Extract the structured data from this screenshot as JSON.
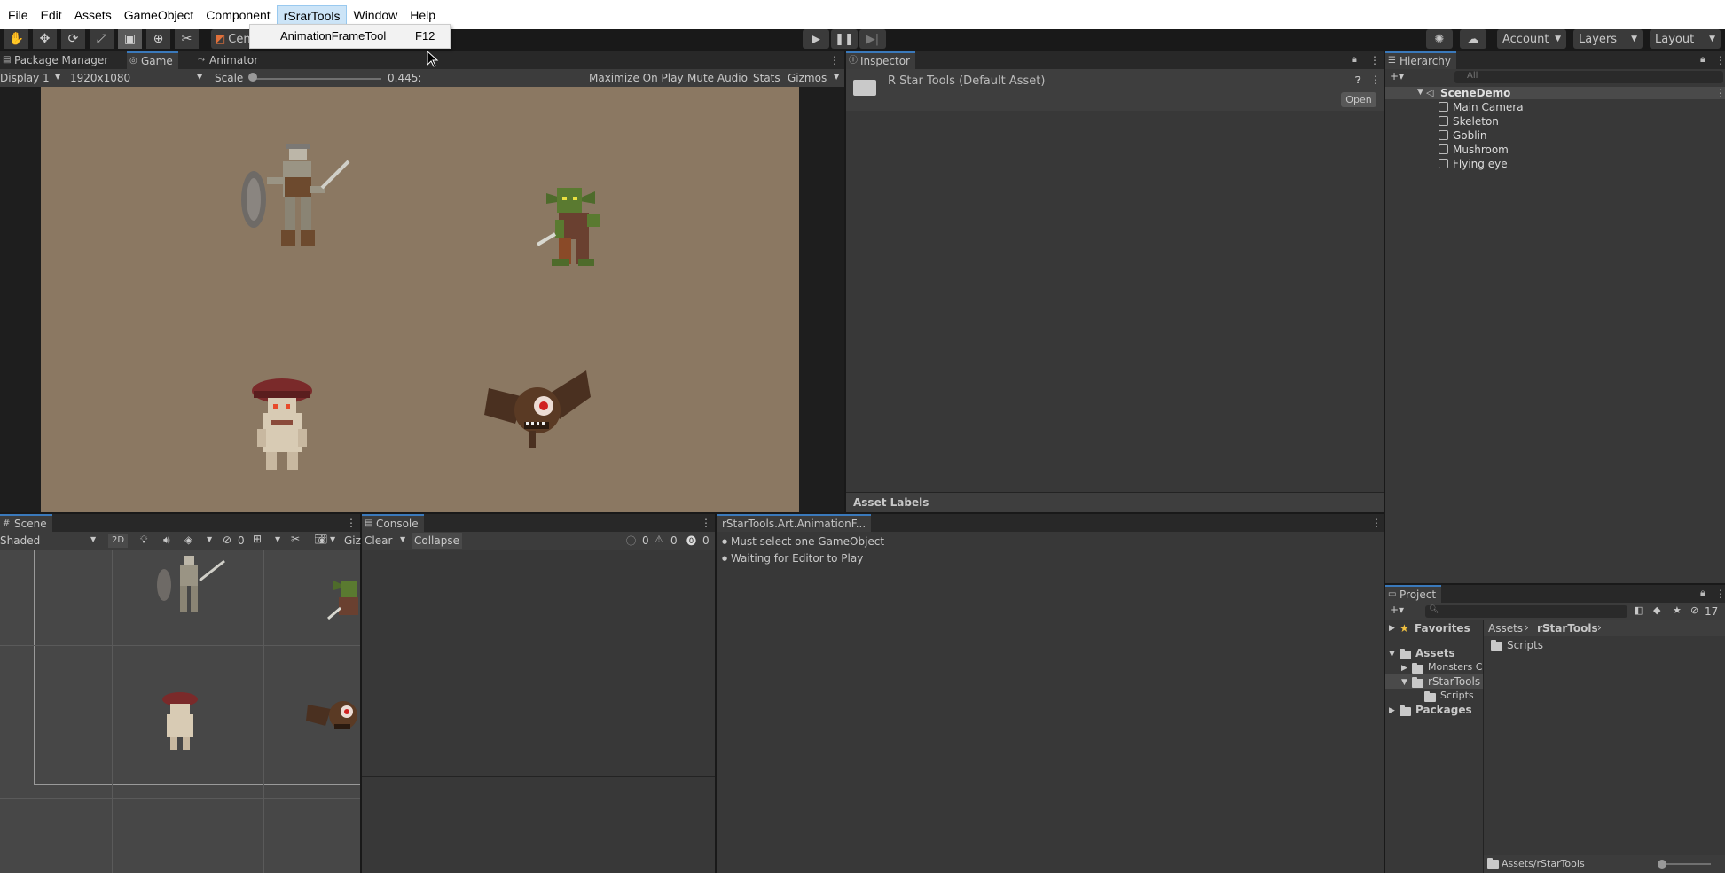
{
  "menu": {
    "file": "File",
    "edit": "Edit",
    "assets": "Assets",
    "gameobject": "GameObject",
    "component": "Component",
    "rstartools": "rSrarTools",
    "window": "Window",
    "help": "Help"
  },
  "dropdown": {
    "item_label": "AnimationFrameTool",
    "shortcut": "F12"
  },
  "toolbar": {
    "center_label": "Cen",
    "account_label": "Account",
    "layers_label": "Layers",
    "layout_label": "Layout"
  },
  "game_panel": {
    "tabs": [
      "Package Manager",
      "Game",
      "Animator"
    ],
    "display": "Display 1",
    "resolution": "1920x1080",
    "scale_label": "Scale",
    "scale_value": "0.445:",
    "maximize": "Maximize On Play",
    "mute": "Mute Audio",
    "stats": "Stats",
    "gizmos": "Gizmos"
  },
  "inspector": {
    "tab": "Inspector",
    "asset_name": "R Star Tools (Default Asset)",
    "open_button": "Open",
    "asset_labels": "Asset Labels"
  },
  "hierarchy": {
    "tab": "Hierarchy",
    "search_placeholder": "All",
    "scene": "SceneDemo",
    "items": [
      "Main Camera",
      "Skeleton",
      "Goblin",
      "Mushroom",
      "Flying eye"
    ]
  },
  "scene_panel": {
    "tab": "Scene",
    "shading": "Shaded",
    "mode_2d": "2D",
    "hidden_count": "0",
    "giz": "Giz"
  },
  "console": {
    "tab": "Console",
    "clear": "Clear",
    "collapse": "Collapse",
    "info_count": "0",
    "warn_count": "0",
    "error_count": "0"
  },
  "tool_panel": {
    "tab": "rStarTools.Art.AnimationF...",
    "lines": [
      "Must select one GameObject",
      "Waiting for Editor to Play"
    ]
  },
  "project": {
    "tab": "Project",
    "count": "17",
    "favorites": "Favorites",
    "assets": "Assets",
    "monsters": "Monsters C",
    "rstartools": "rStarTools",
    "scripts": "Scripts",
    "packages": "Packages",
    "breadcrumb_root": "Assets",
    "breadcrumb_current": "rStarTools",
    "content_folder": "Scripts",
    "footer_path": "Assets/rStarTools"
  },
  "colors": {
    "game_bg": "#8b7862",
    "accent": "#3a79bb",
    "panel_bg": "#383838"
  }
}
